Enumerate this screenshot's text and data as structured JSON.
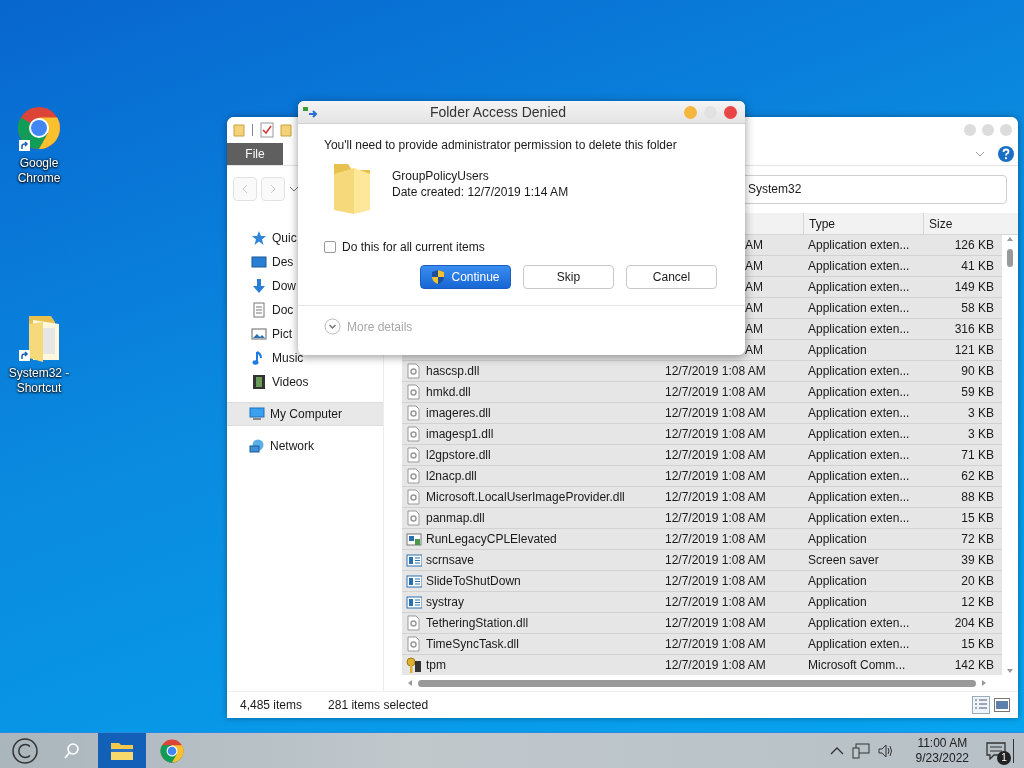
{
  "desktop_icons": [
    {
      "label": "Google Chrome",
      "kind": "chrome"
    },
    {
      "label": "System32 - Shortcut",
      "kind": "folder"
    }
  ],
  "explorer": {
    "ribbon_tab": "File",
    "address": "System32",
    "nav": [
      {
        "label": "Quic",
        "kind": "star",
        "selected": false
      },
      {
        "label": "Des",
        "kind": "desktop",
        "selected": false
      },
      {
        "label": "Dow",
        "kind": "download",
        "selected": false
      },
      {
        "label": "Doc",
        "kind": "document",
        "selected": false
      },
      {
        "label": "Pict",
        "kind": "picture",
        "selected": false
      },
      {
        "label": "Music",
        "kind": "music",
        "selected": false
      },
      {
        "label": "Videos",
        "kind": "video",
        "selected": false
      },
      {
        "label": "My Computer",
        "kind": "computer",
        "selected": true
      },
      {
        "label": "Network",
        "kind": "network",
        "selected": false
      }
    ],
    "columns": [
      "Type",
      "Size"
    ],
    "rows": [
      {
        "date": "AM",
        "type": "Application exten...",
        "size": "126 KB",
        "selected": true
      },
      {
        "date": "AM",
        "type": "Application exten...",
        "size": "41 KB",
        "selected": true
      },
      {
        "date": "AM",
        "type": "Application exten...",
        "size": "149 KB",
        "selected": true
      },
      {
        "date": "AM",
        "type": "Application exten...",
        "size": "58 KB",
        "selected": true
      },
      {
        "date": "AM",
        "type": "Application exten...",
        "size": "316 KB",
        "selected": true
      },
      {
        "date": "AM",
        "type": "Application",
        "size": "121 KB",
        "selected": true
      },
      {
        "name": "hascsp.dll",
        "kind": "dll",
        "date": "12/7/2019 1:08 AM",
        "type": "Application exten...",
        "size": "90 KB",
        "selected": true
      },
      {
        "name": "hmkd.dll",
        "kind": "dll",
        "date": "12/7/2019 1:08 AM",
        "type": "Application exten...",
        "size": "59 KB",
        "selected": true
      },
      {
        "name": "imageres.dll",
        "kind": "dll",
        "date": "12/7/2019 1:08 AM",
        "type": "Application exten...",
        "size": "3 KB",
        "selected": true
      },
      {
        "name": "imagesp1.dll",
        "kind": "dll",
        "date": "12/7/2019 1:08 AM",
        "type": "Application exten...",
        "size": "3 KB",
        "selected": true
      },
      {
        "name": "l2gpstore.dll",
        "kind": "dll",
        "date": "12/7/2019 1:08 AM",
        "type": "Application exten...",
        "size": "71 KB",
        "selected": true
      },
      {
        "name": "l2nacp.dll",
        "kind": "dll",
        "date": "12/7/2019 1:08 AM",
        "type": "Application exten...",
        "size": "62 KB",
        "selected": true
      },
      {
        "name": "Microsoft.LocalUserImageProvider.dll",
        "kind": "dll",
        "date": "12/7/2019 1:08 AM",
        "type": "Application exten...",
        "size": "88 KB",
        "selected": true
      },
      {
        "name": "panmap.dll",
        "kind": "dll",
        "date": "12/7/2019 1:08 AM",
        "type": "Application exten...",
        "size": "15 KB",
        "selected": true
      },
      {
        "name": "RunLegacyCPLElevated",
        "kind": "app",
        "date": "12/7/2019 1:08 AM",
        "type": "Application",
        "size": "72 KB",
        "selected": true
      },
      {
        "name": "scrnsave",
        "kind": "window",
        "date": "12/7/2019 1:08 AM",
        "type": "Screen saver",
        "size": "39 KB",
        "selected": true
      },
      {
        "name": "SlideToShutDown",
        "kind": "window",
        "date": "12/7/2019 1:08 AM",
        "type": "Application",
        "size": "20 KB",
        "selected": true
      },
      {
        "name": "systray",
        "kind": "window",
        "date": "12/7/2019 1:08 AM",
        "type": "Application",
        "size": "12 KB",
        "selected": true
      },
      {
        "name": "TetheringStation.dll",
        "kind": "dll",
        "date": "12/7/2019 1:08 AM",
        "type": "Application exten...",
        "size": "204 KB",
        "selected": true
      },
      {
        "name": "TimeSyncTask.dll",
        "kind": "dll",
        "date": "12/7/2019 1:08 AM",
        "type": "Application exten...",
        "size": "15 KB",
        "selected": true
      },
      {
        "name": "tpm",
        "kind": "key",
        "date": "12/7/2019 1:08 AM",
        "type": "Microsoft Comm...",
        "size": "142 KB",
        "selected": true
      }
    ],
    "status": {
      "count": "4,485 items",
      "selection": "281 items selected"
    }
  },
  "dialog": {
    "title": "Folder Access Denied",
    "message": "You'll need to provide administrator permission to delete this folder",
    "item_name": "GroupPolicyUsers",
    "item_date": "Date created: 12/7/2019 1:14 AM",
    "checkbox": {
      "label": "Do this for all current items",
      "checked": false
    },
    "buttons": [
      {
        "label": "Continue",
        "primary": true
      },
      {
        "label": "Skip",
        "primary": false
      },
      {
        "label": "Cancel",
        "primary": false
      }
    ],
    "more_details": {
      "label": "More details",
      "disabled": true
    }
  },
  "taskbar": {
    "apps": [
      {
        "kind": "explorer",
        "active": true
      },
      {
        "kind": "chrome",
        "active": false
      }
    ],
    "time": "11:00 AM",
    "date": "9/23/2022",
    "notification_count": "1"
  }
}
